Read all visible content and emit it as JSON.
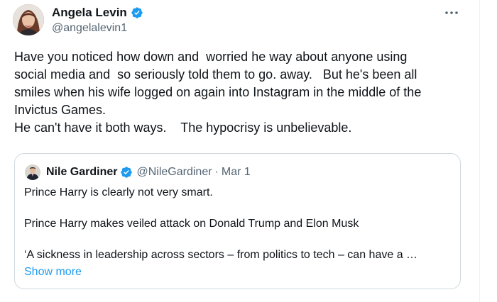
{
  "tweet": {
    "author": {
      "display_name": "Angela Levin",
      "handle": "@angelalevin1",
      "verified": true
    },
    "more_icon": "ellipsis-icon",
    "text_lines": [
      "Have you noticed how down and  worried he way about anyone using",
      "social media and  so seriously told them to go. away.   But he's been all",
      "smiles when his wife logged on again into Instagram in the middle of the",
      "Invictus Games.",
      "He can't have it both ways.    The hypocrisy is unbelievable."
    ]
  },
  "quote": {
    "author": {
      "display_name": "Nile Gardiner",
      "handle": "@NileGardiner",
      "separator": "·",
      "date": "Mar 1",
      "verified": true
    },
    "lines": [
      "Prince Harry is clearly not very smart.",
      "Prince Harry makes veiled attack on Donald Trump and Elon Musk",
      "‘A sickness in leadership across sectors – from politics to tech – can  have a …"
    ],
    "show_more": "Show more"
  },
  "colors": {
    "text": "#0f1419",
    "secondary": "#536471",
    "accent": "#1d9bf0",
    "border": "#cfd9de"
  }
}
